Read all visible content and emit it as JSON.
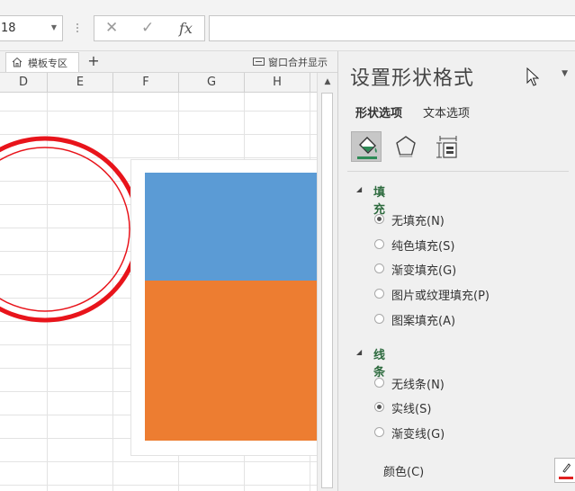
{
  "formula_bar": {
    "name_box": "18",
    "formula": ""
  },
  "sheet_tabs": {
    "template_tab": "模板专区",
    "add": "+",
    "window_merge": "窗口合并显示"
  },
  "columns": [
    "D",
    "E",
    "F",
    "G",
    "H"
  ],
  "shapes": {
    "circle_color": "#e8141b",
    "rect_top_color": "#5b9bd5",
    "rect_bottom_color": "#ed7d31"
  },
  "format_pane": {
    "title": "设置形状格式",
    "tabs": {
      "shape_options": "形状选项",
      "text_options": "文本选项"
    },
    "fill_section": {
      "title": "填充",
      "options": [
        "无填充(N)",
        "纯色填充(S)",
        "渐变填充(G)",
        "图片或纹理填充(P)",
        "图案填充(A)"
      ],
      "selected": "无填充(N)"
    },
    "line_section": {
      "title": "线条",
      "options": [
        "无线条(N)",
        "实线(S)",
        "渐变线(G)"
      ],
      "selected": "实线(S)"
    },
    "color_label": "颜色(C)",
    "line_color": "#e02020"
  }
}
